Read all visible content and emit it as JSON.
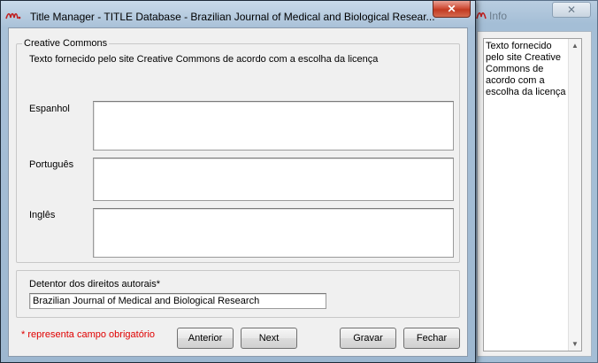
{
  "info_window": {
    "title": "Info",
    "text": "Texto fornecido pelo site Creative Commons de acordo com a escolha da licença"
  },
  "main_window": {
    "title": "Title Manager - TITLE Database - Brazilian Journal of Medical and Biological Resear...",
    "close_symbol": "✕"
  },
  "creative_commons": {
    "legend": "Creative Commons",
    "description": "Texto fornecido pelo site Creative Commons de acordo com a escolha da licença",
    "fields": [
      {
        "label": "Espanhol",
        "value": ""
      },
      {
        "label": "Português",
        "value": ""
      },
      {
        "label": "Inglês",
        "value": ""
      }
    ]
  },
  "copyright": {
    "label": "Detentor dos direitos autorais*",
    "value": "Brazilian Journal of Medical and Biological Research"
  },
  "required_note": "* representa campo obrigatório",
  "buttons": {
    "previous": "Anterior",
    "next": "Next",
    "save": "Gravar",
    "close": "Fechar"
  },
  "colors": {
    "required": "#e00000",
    "close_button": "#c23a22"
  },
  "icons": {
    "app_logo": "scielo-logo-icon",
    "close": "close-icon",
    "scroll_up": "scroll-up-arrow-icon",
    "scroll_down": "scroll-down-arrow-icon"
  }
}
